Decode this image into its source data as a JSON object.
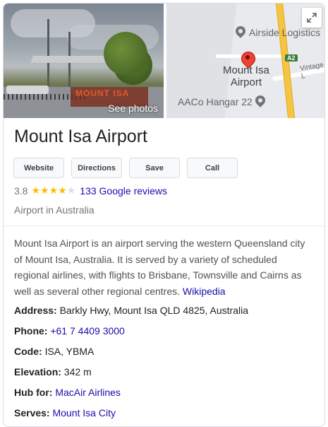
{
  "media": {
    "photo_sign_text": "MOUNT ISA",
    "see_photos_label": "See photos",
    "map": {
      "airside_label": "Airside Logistics",
      "airport_label_line1": "Mount Isa",
      "airport_label_line2": "Airport",
      "hangar_label": "AACo Hangar 22",
      "road_shield": "A2",
      "road_label": "Vintage L",
      "expand_icon": "expand-icon"
    }
  },
  "title": "Mount Isa Airport",
  "actions": {
    "website": "Website",
    "directions": "Directions",
    "save": "Save",
    "call": "Call"
  },
  "rating": {
    "value": "3.8",
    "stars_filled": 4,
    "stars_total": 5,
    "reviews_label": "133 Google reviews"
  },
  "category": "Airport in Australia",
  "description": {
    "text": "Mount Isa Airport is an airport serving the western Queensland city of Mount Isa, Australia. It is served by a variety of scheduled regional airlines, with flights to Brisbane, Townsville and Cairns as well as several other regional centres.",
    "source_link": "Wikipedia"
  },
  "facts": {
    "address": {
      "label": "Address:",
      "value": "Barkly Hwy, Mount Isa QLD 4825, Australia"
    },
    "phone": {
      "label": "Phone:",
      "value": "+61 7 4409 3000"
    },
    "code": {
      "label": "Code:",
      "value": "ISA, YBMA"
    },
    "elevation": {
      "label": "Elevation:",
      "value": "342 m"
    },
    "hub_for": {
      "label": "Hub for:",
      "value": "MacAir Airlines"
    },
    "serves": {
      "label": "Serves:",
      "value": "Mount Isa City"
    }
  },
  "colors": {
    "link": "#1a0dab",
    "star": "#fbbc04",
    "pin": "#ea4335"
  }
}
